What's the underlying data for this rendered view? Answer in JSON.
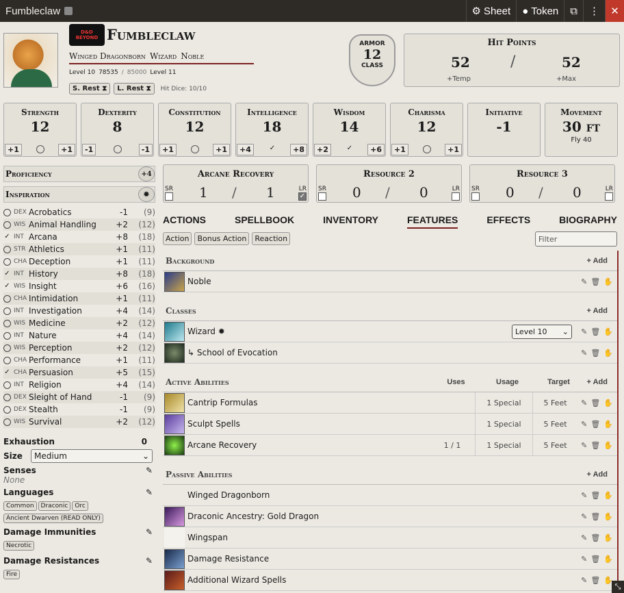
{
  "window": {
    "title": "Fumbleclaw",
    "sheet_label": "Sheet",
    "token_label": "Token",
    "close_label": "✕"
  },
  "header": {
    "logo_text": "D&D BEYOND",
    "name": "Fumbleclaw",
    "race": "Winged Dragonborn",
    "class": "Wizard",
    "background": "Noble",
    "level": "Level 10",
    "xp": "78535",
    "xp_next": "85000",
    "next_level": "Level 11",
    "short_rest": "S. Rest",
    "long_rest": "L. Rest",
    "hit_dice": "Hit Dice: 10/10"
  },
  "armor": {
    "label": "ARMOR",
    "value": "12",
    "sub": "CLASS"
  },
  "hp": {
    "title": "Hit Points",
    "current": "52",
    "max": "52",
    "temp_label": "+Temp",
    "max_label": "+Max"
  },
  "abilities": [
    {
      "name": "Strength",
      "value": "12",
      "mod": "+1",
      "save": "+1",
      "proficient": false
    },
    {
      "name": "Dexterity",
      "value": "8",
      "mod": "-1",
      "save": "-1",
      "proficient": false
    },
    {
      "name": "Constitution",
      "value": "12",
      "mod": "+1",
      "save": "+1",
      "proficient": false
    },
    {
      "name": "Intelligence",
      "value": "18",
      "mod": "+4",
      "save": "+8",
      "proficient": true
    },
    {
      "name": "Wisdom",
      "value": "14",
      "mod": "+2",
      "save": "+6",
      "proficient": true
    },
    {
      "name": "Charisma",
      "value": "12",
      "mod": "+1",
      "save": "+1",
      "proficient": false
    }
  ],
  "initiative": {
    "name": "Initiative",
    "value": "-1"
  },
  "movement": {
    "name": "Movement",
    "value": "30",
    "unit": "FT",
    "sub": "Fly 40"
  },
  "proficiency": {
    "label": "Proficiency",
    "value": "+4"
  },
  "inspiration": {
    "label": "Inspiration"
  },
  "skills": [
    {
      "ab": "DEX",
      "name": "Acrobatics",
      "bonus": "-1",
      "passive": "(9)",
      "prof": false
    },
    {
      "ab": "WIS",
      "name": "Animal Handling",
      "bonus": "+2",
      "passive": "(12)",
      "prof": false
    },
    {
      "ab": "INT",
      "name": "Arcana",
      "bonus": "+8",
      "passive": "(18)",
      "prof": true
    },
    {
      "ab": "STR",
      "name": "Athletics",
      "bonus": "+1",
      "passive": "(11)",
      "prof": false
    },
    {
      "ab": "CHA",
      "name": "Deception",
      "bonus": "+1",
      "passive": "(11)",
      "prof": false
    },
    {
      "ab": "INT",
      "name": "History",
      "bonus": "+8",
      "passive": "(18)",
      "prof": true
    },
    {
      "ab": "WIS",
      "name": "Insight",
      "bonus": "+6",
      "passive": "(16)",
      "prof": true
    },
    {
      "ab": "CHA",
      "name": "Intimidation",
      "bonus": "+1",
      "passive": "(11)",
      "prof": false
    },
    {
      "ab": "INT",
      "name": "Investigation",
      "bonus": "+4",
      "passive": "(14)",
      "prof": false
    },
    {
      "ab": "WIS",
      "name": "Medicine",
      "bonus": "+2",
      "passive": "(12)",
      "prof": false
    },
    {
      "ab": "INT",
      "name": "Nature",
      "bonus": "+4",
      "passive": "(14)",
      "prof": false
    },
    {
      "ab": "WIS",
      "name": "Perception",
      "bonus": "+2",
      "passive": "(12)",
      "prof": false
    },
    {
      "ab": "CHA",
      "name": "Performance",
      "bonus": "+1",
      "passive": "(11)",
      "prof": false
    },
    {
      "ab": "CHA",
      "name": "Persuasion",
      "bonus": "+5",
      "passive": "(15)",
      "prof": true
    },
    {
      "ab": "INT",
      "name": "Religion",
      "bonus": "+4",
      "passive": "(14)",
      "prof": false
    },
    {
      "ab": "DEX",
      "name": "Sleight of Hand",
      "bonus": "-1",
      "passive": "(9)",
      "prof": false
    },
    {
      "ab": "DEX",
      "name": "Stealth",
      "bonus": "-1",
      "passive": "(9)",
      "prof": false
    },
    {
      "ab": "WIS",
      "name": "Survival",
      "bonus": "+2",
      "passive": "(12)",
      "prof": false
    }
  ],
  "misc": {
    "exhaustion_label": "Exhaustion",
    "exhaustion_value": "0",
    "size_label": "Size",
    "size_value": "Medium",
    "senses_label": "Senses",
    "senses_value": "None",
    "languages_label": "Languages",
    "languages": [
      "Common",
      "Draconic",
      "Orc",
      "Ancient Dwarven (READ ONLY)"
    ],
    "immunities_label": "Damage Immunities",
    "immunities": [
      "Necrotic"
    ],
    "resistances_label": "Damage Resistances",
    "resistances": [
      "Fire"
    ]
  },
  "resources": [
    {
      "title": "Arcane Recovery",
      "value": "1",
      "max": "1",
      "sr": false,
      "lr": true
    },
    {
      "title": "Resource 2",
      "value": "0",
      "max": "0",
      "sr": false,
      "lr": false
    },
    {
      "title": "Resource 3",
      "value": "0",
      "max": "0",
      "sr": false,
      "lr": false
    }
  ],
  "tabs": [
    "ACTIONS",
    "SPELLBOOK",
    "INVENTORY",
    "FEATURES",
    "EFFECTS",
    "BIOGRAPHY"
  ],
  "active_tab": "FEATURES",
  "filters": [
    "Action",
    "Bonus Action",
    "Reaction"
  ],
  "filter_placeholder": "Filter",
  "features": {
    "add_label": "Add",
    "background": {
      "title": "Background",
      "items": [
        "Noble"
      ]
    },
    "classes": {
      "title": "Classes",
      "wizard": "Wizard",
      "level_select": "Level 10",
      "subclass": "↳ School of Evocation"
    },
    "active": {
      "title": "Active Abilities",
      "cols": [
        "Uses",
        "Usage",
        "Target"
      ],
      "items": [
        {
          "name": "Cantrip Formulas",
          "uses": "",
          "usage": "1 Special",
          "target": "5 Feet"
        },
        {
          "name": "Sculpt Spells",
          "uses": "",
          "usage": "1 Special",
          "target": "5 Feet"
        },
        {
          "name": "Arcane Recovery",
          "uses": "1 / 1",
          "usage": "1 Special",
          "target": "5 Feet"
        }
      ]
    },
    "passive": {
      "title": "Passive Abilities",
      "items": [
        "Winged Dragonborn",
        "Draconic Ancestry: Gold Dragon",
        "Wingspan",
        "Damage Resistance",
        "Additional Wizard Spells"
      ]
    }
  },
  "colors": {
    "accent": "#7a1f1f",
    "titlebar": "#2e2b27",
    "close": "#c0392b"
  }
}
